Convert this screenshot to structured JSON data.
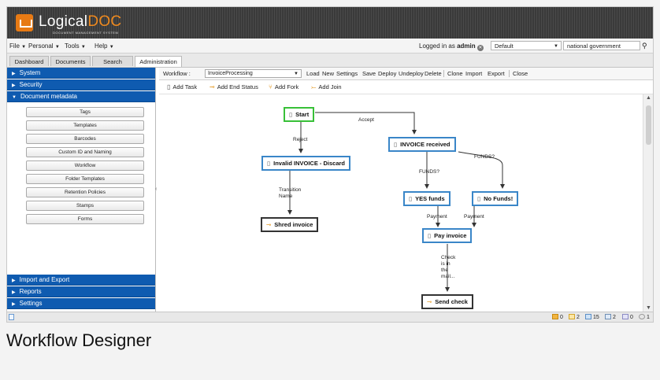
{
  "app": {
    "logo_main": "Logical",
    "logo_accent": "DOC",
    "logo_subtitle": "DOCUMENT MANAGEMENT SYSTEM",
    "brand_color": "#f08a1e"
  },
  "menu": {
    "items": [
      "File",
      "Personal",
      "Tools",
      "Help"
    ],
    "logged_prefix": "Logged in as",
    "logged_user": "admin",
    "workspace_combo": "Default",
    "search_value": "national government"
  },
  "tabs": [
    {
      "label": "Dashboard"
    },
    {
      "label": "Documents"
    },
    {
      "label": "Search"
    },
    {
      "label": "Administration",
      "active": true
    }
  ],
  "sidebar": {
    "sections_top": [
      "System",
      "Security",
      "Document metadata"
    ],
    "metadata_items": [
      "Tags",
      "Templates",
      "Barcodes",
      "Custom ID and Naming",
      "Workflow",
      "Folder Templates",
      "Retention Policies",
      "Stamps",
      "Forms"
    ],
    "sections_bottom": [
      "Import and Export",
      "Reports",
      "Settings"
    ],
    "header_color": "#0f5bb0"
  },
  "workflow_toolbar": {
    "label": "Workflow :",
    "selected_workflow": "InvoiceProcessing",
    "actions": [
      "Load",
      "New",
      "Settings",
      "Save",
      "Deploy",
      "Undeploy",
      "Delete",
      "Clone",
      "Import",
      "Export",
      "Close"
    ]
  },
  "edit_toolbar": {
    "actions": [
      "Add Task",
      "Add End Status",
      "Add Fork",
      "Add Join"
    ]
  },
  "diagram": {
    "nodes": {
      "start": "Start",
      "invoice_received": "INVOICE received",
      "invalid_invoice": "Invalid INVOICE - Discard",
      "yes_funds": "YES funds",
      "no_funds": "No Funds!",
      "shred_invoice": "Shred invoice",
      "pay_invoice": "Pay invoice",
      "send_check": "Send check"
    },
    "edge_labels": {
      "accept": "Accept",
      "reject": "Reject",
      "funds_left": "FUNDS?",
      "funds_right": "FUNDS?",
      "transition_name": [
        "Transition",
        "Name"
      ],
      "payment_left": "Payment",
      "payment_right": "Payment",
      "check_mail": [
        "Check",
        "is in",
        "the",
        "mail..."
      ]
    },
    "colors": {
      "start_border": "#38c038",
      "task_border": "#3a86c8",
      "end_border": "#333333"
    }
  },
  "statusbar": {
    "counters": [
      "0",
      "2",
      "15",
      "2",
      "0",
      "1"
    ]
  },
  "caption": "Workflow Designer"
}
